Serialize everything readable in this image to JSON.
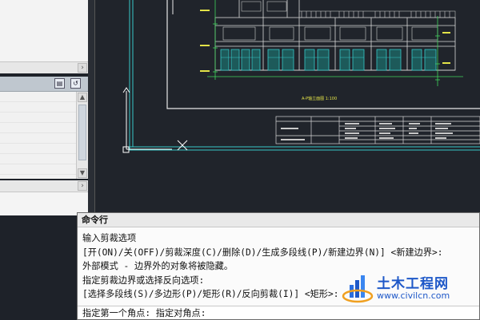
{
  "command_window": {
    "title": "命令行",
    "history": [
      "输入剪裁选项",
      "[开(ON)/关(OFF)/剪裁深度(C)/删除(D)/生成多段线(P)/新建边界(N)] <新建边界>:",
      "外部模式 - 边界外的对象将被隐藏。",
      "指定剪裁边界或选择反向选项:",
      "[选择多段线(S)/多边形(P)/矩形(R)/反向剪裁(I)] <矩形>:"
    ],
    "current_prompt": "指定第一个角点: 指定对角点:"
  },
  "drawing": {
    "elevation_label": "A-P轴立面图 1:100"
  },
  "watermark": {
    "name_cn": "土木工程网",
    "url": "www.civilcn.com"
  },
  "icons": {
    "scroll_right": "chevron-right-icon",
    "scroll_up": "chevron-up-icon",
    "scroll_down": "chevron-down-icon",
    "panel_buttons": [
      "panel-options-icon",
      "panel-refresh-icon"
    ]
  },
  "colors": {
    "canvas_bg": "#20242b",
    "border_white": "#e8e8e8",
    "cyan": "#37c9c9",
    "green": "#3fd45c",
    "yellow": "#e3e348",
    "brand_blue": "#1e58c8"
  }
}
